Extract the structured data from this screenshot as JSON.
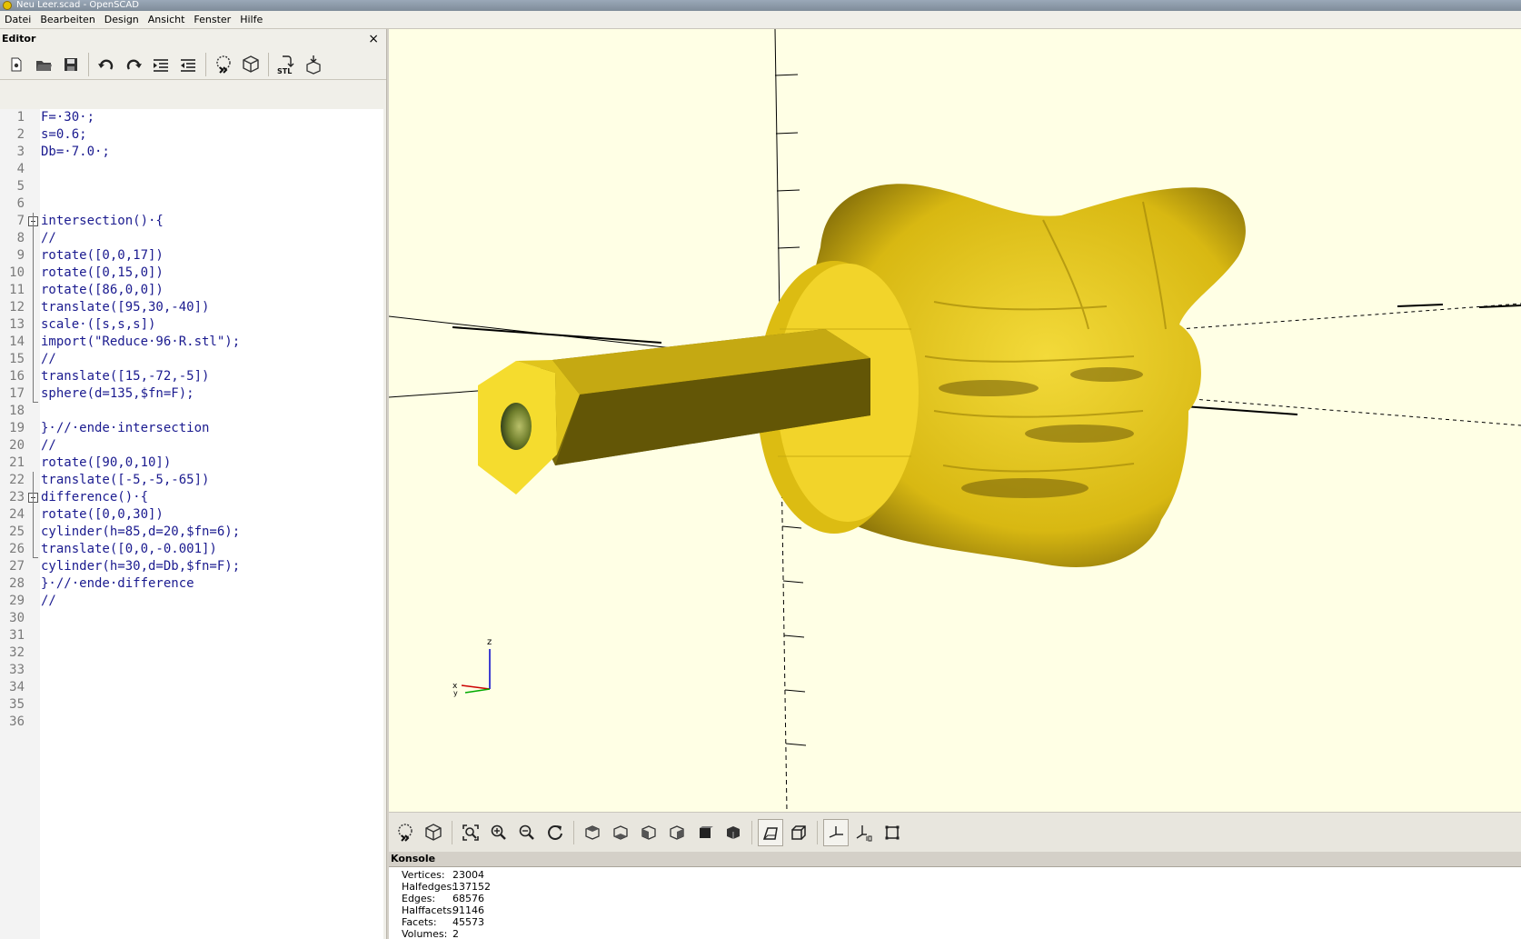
{
  "window": {
    "title": "Neu Leer.scad - OpenSCAD"
  },
  "menu": [
    "Datei",
    "Bearbeiten",
    "Design",
    "Ansicht",
    "Fenster",
    "Hilfe"
  ],
  "editor": {
    "title": "Editor",
    "close_glyph": "×",
    "toolbar": [
      "new-file-icon",
      "open-file-icon",
      "save-icon",
      "undo-icon",
      "redo-icon",
      "indent-icon",
      "unindent-icon",
      "preview-icon",
      "render-icon",
      "export-stl-icon",
      "send-to-print-icon"
    ],
    "stl_label": "STL",
    "lines": [
      "F=·30·;",
      "s=0.6;",
      "Db=·7.0·;",
      "",
      "",
      "",
      "intersection()·{",
      "//",
      "rotate([0,0,17])",
      "rotate([0,15,0])",
      "rotate([86,0,0])",
      "translate([95,30,-40])",
      "scale·([s,s,s])",
      "import(\"Reduce·96·R.stl\");",
      "//",
      "translate([15,-72,-5])",
      "sphere(d=135,$fn=F);",
      "",
      "}·//·ende·intersection",
      "//",
      "rotate([90,0,10])",
      "translate([-5,-5,-65])",
      "difference()·{",
      "rotate([0,0,30])",
      "cylinder(h=85,d=20,$fn=6);",
      "translate([0,0,-0.001])",
      "cylinder(h=30,d=Db,$fn=F);",
      "}·//·ende·difference",
      "//",
      "",
      "",
      "",
      "",
      "",
      "",
      ""
    ]
  },
  "viewport": {
    "background": "#ffffe5",
    "model_color": "#f0d21e",
    "axis_label_z": "z",
    "axis_label_x": "x",
    "axis_label_y": "y"
  },
  "view_toolbar": [
    "preview-icon",
    "render-icon",
    "view-all-icon",
    "zoom-in-icon",
    "zoom-out-icon",
    "reset-view-icon",
    "view-top-icon",
    "view-bottom-icon",
    "view-left-icon",
    "view-right-icon",
    "view-front-icon",
    "view-back-icon",
    "perspective-icon",
    "orthogonal-icon",
    "show-axes-icon",
    "show-scale-markers-icon",
    "show-edges-icon"
  ],
  "console": {
    "title": "Konsole",
    "stats": [
      {
        "key": "Vertices:",
        "value": "23004"
      },
      {
        "key": "Halfedges:",
        "value": "137152"
      },
      {
        "key": "Edges:",
        "value": "68576"
      },
      {
        "key": "Halffacets:",
        "value": "91146"
      },
      {
        "key": "Facets:",
        "value": "45573"
      },
      {
        "key": "Volumes:",
        "value": "2"
      }
    ]
  }
}
